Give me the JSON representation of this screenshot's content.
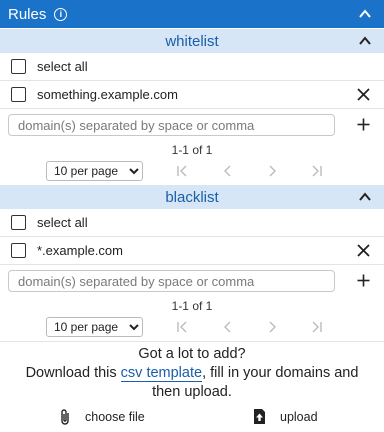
{
  "header": {
    "title": "Rules",
    "info_icon": "info-icon",
    "collapse_icon": "chevron-up-icon",
    "color": "#1a73c8"
  },
  "whitelist": {
    "title": "whitelist",
    "select_all": "select all",
    "items": [
      {
        "domain": "something.example.com"
      }
    ],
    "input_placeholder": "domain(s) separated by space or comma",
    "range": "1-1 of 1",
    "per_page": "10 per page",
    "per_page_options": [
      "10 per page"
    ]
  },
  "blacklist": {
    "title": "blacklist",
    "select_all": "select all",
    "items": [
      {
        "domain": "*.example.com"
      }
    ],
    "input_placeholder": "domain(s) separated by space or comma",
    "range": "1-1 of 1",
    "per_page": "10 per page",
    "per_page_options": [
      "10 per page"
    ]
  },
  "footer": {
    "heading": "Got a lot to add?",
    "line_before_link": "Download this ",
    "link_text": "csv template",
    "line_after_link": ", fill in your domains and",
    "line_end": "then upload.",
    "choose_file": "choose file",
    "upload": "upload"
  },
  "colors": {
    "accent": "#1a73c8",
    "section_bg": "#d6e6f7",
    "section_text": "#1a5fa8"
  }
}
